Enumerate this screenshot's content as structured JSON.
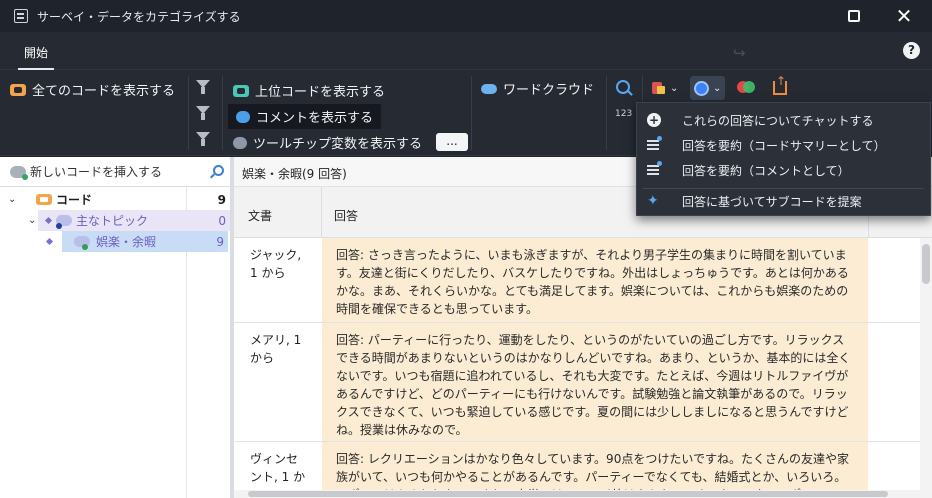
{
  "window": {
    "title": "サーベイ・データをカテゴライズする",
    "maximize_icon": "maximize-icon",
    "close_glyph": "✕"
  },
  "tabs": [
    {
      "label": "開始",
      "active": true
    }
  ],
  "ribbon": {
    "show_all_codes": "全てのコードを表示する",
    "show_top_codes": "上位コードを表示する",
    "show_comments": "コメントを表示する",
    "show_tooltip_vars": "ツールチップ変数を表示する",
    "ellipsis": "...",
    "word_cloud": "ワードクラウド",
    "number_label": "123"
  },
  "menu": {
    "items": [
      {
        "label": "これらの回答についてチャットする",
        "icon": "chat-plus-icon"
      },
      {
        "label": "回答を要約（コードサマリーとして）",
        "icon": "summary-lines-icon"
      },
      {
        "label": "回答を要約（コメントとして）",
        "icon": "summary-lines-icon"
      },
      {
        "label": "回答に基づいてサブコードを提案",
        "icon": "sparkle-icon"
      }
    ]
  },
  "left_panel": {
    "new_code": "新しいコードを挿入する",
    "tree": [
      {
        "label": "コード",
        "count": "9",
        "level": 0,
        "bold": true
      },
      {
        "label": "主なトピック",
        "count": "0",
        "level": 1
      },
      {
        "label": "娯楽・余暇",
        "count": "9",
        "level": 2
      }
    ]
  },
  "right_panel": {
    "category_header": "娯楽・余暇(9 回答)",
    "columns": {
      "doc": "文書",
      "answer": "回答"
    },
    "rows": [
      {
        "doc": "ジャック, 1 から",
        "answer": "回答: さっき言ったように、いまも泳ぎますが、それより男子学生の集まりに時間を割いています。友達と街にくりだしたり、バスケしたりですね。外出はしょっちゅうです。あとは何かあるかな。まあ、それくらいかな。とても満足してます。娯楽については、これからも娯楽のための時間を確保できるとも思っています。"
      },
      {
        "doc": "メアリ, 1 から",
        "answer": "回答: パーティーに行ったり、運動をしたり、というのがたいていの過ごし方です。リラックスできる時間があまりないというのはかなりしんどいですね。あまり、というか、基本的には全くないです。いつも宿題に追われているし、それも大変です。たとえば、今週はリトルファイヴがあるんですけど、どのパーティーにも行けないんです。試験勉強と論文執筆があるので。リラックスできなくて、いつも緊迫している感じです。夏の間には少ししましになると思うんですけどね。授業は休みなので。"
      },
      {
        "doc": "ヴィンセント, 1 か",
        "answer": "回答: レクリエーションはかなり色々しています。90点をつけたいですね。たくさんの友達や家族がいて、いつも何かやることがあるんです。パーティーでなくても、結婚式とか、いろいろ。スポーツはあまりしないですね。大学ではテニス以外はやらないです。ウォータースポーツ"
      }
    ]
  }
}
